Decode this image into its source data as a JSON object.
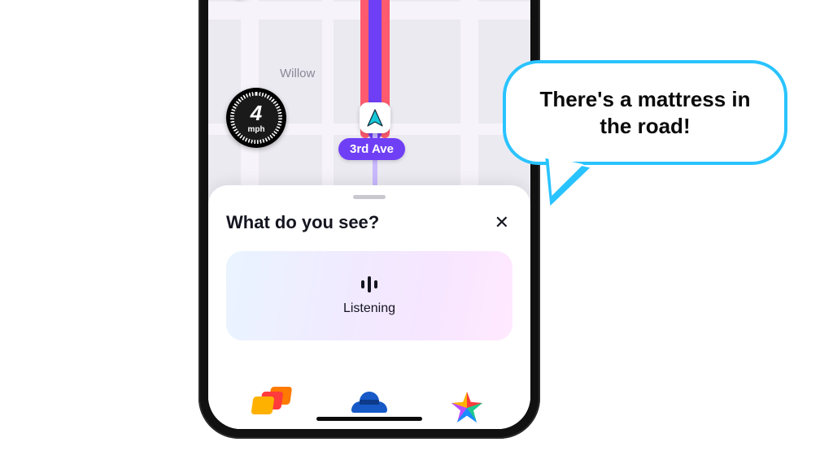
{
  "map": {
    "street_side_label": "Willow",
    "current_street": "3rd Ave"
  },
  "speed": {
    "value": "4",
    "unit": "mph"
  },
  "sheet": {
    "title": "What do you see?",
    "listen_label": "Listening"
  },
  "bubble": {
    "text": "There's a mattress in the road!"
  },
  "reports": {
    "traffic": "traffic",
    "police": "police",
    "hazard": "hazard"
  }
}
